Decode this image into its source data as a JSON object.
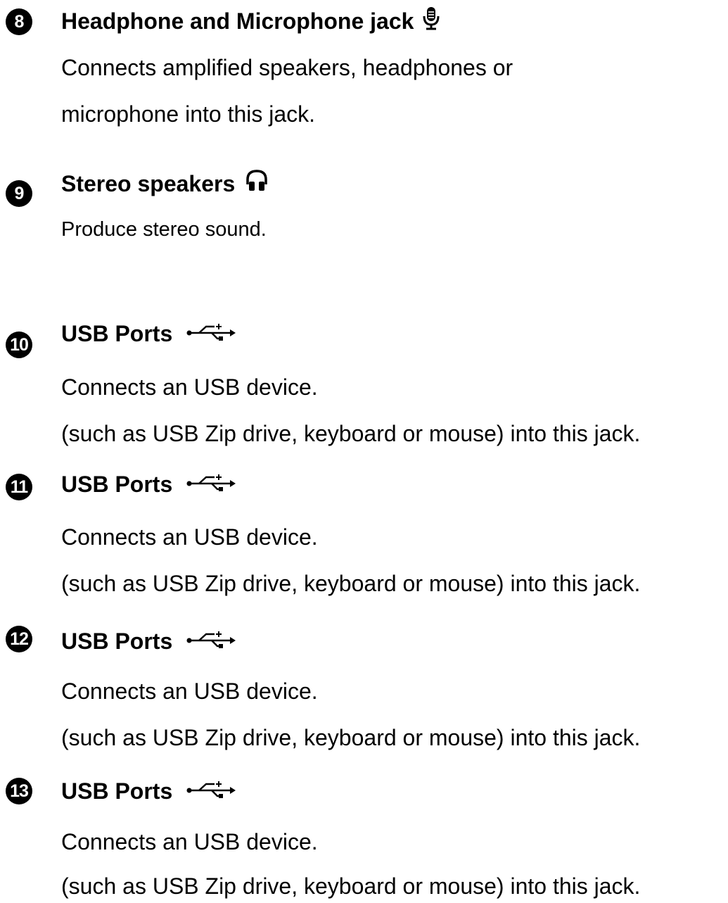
{
  "items": [
    {
      "number": "8",
      "title": "Headphone and Microphone jack",
      "icon": "microphone-icon",
      "lines": [
        "Connects amplified speakers, headphones or",
        "microphone into this jack."
      ]
    },
    {
      "number": "9",
      "title": "Stereo speakers",
      "icon": "headphones-icon",
      "lines": [
        "Produce stereo sound."
      ]
    },
    {
      "number": "10",
      "title": "USB Ports",
      "icon": "usb-icon",
      "lines": [
        "Connects an USB device.",
        "(such as USB Zip drive, keyboard or mouse) into this jack."
      ]
    },
    {
      "number": "11",
      "title": "USB Ports",
      "icon": "usb-icon",
      "lines": [
        "Connects an USB device.",
        "(such as USB Zip drive, keyboard or mouse) into this jack."
      ]
    },
    {
      "number": "12",
      "title": "USB Ports",
      "icon": "usb-icon",
      "lines": [
        "Connects an USB device.",
        "(such as USB Zip drive, keyboard or mouse) into this jack."
      ]
    },
    {
      "number": "13",
      "title": "USB Ports",
      "icon": "usb-icon",
      "lines": [
        "Connects an USB device.",
        "(such as USB Zip drive, keyboard or mouse) into this jack."
      ]
    }
  ]
}
